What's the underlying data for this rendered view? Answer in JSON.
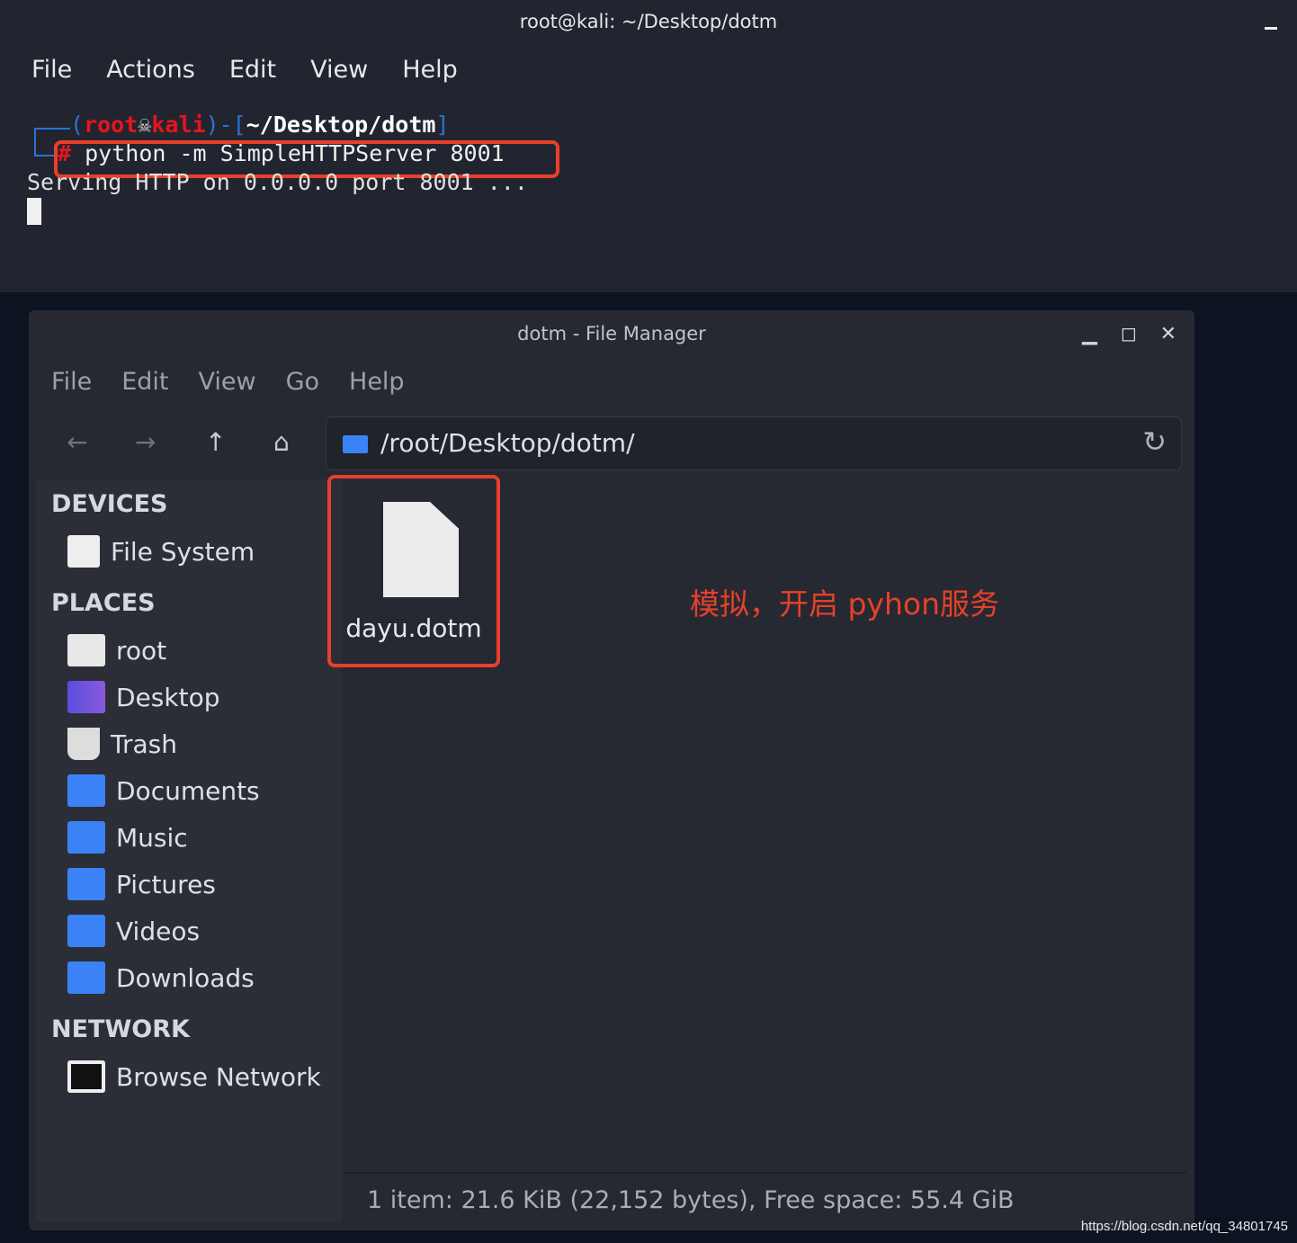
{
  "terminal": {
    "title": "root@kali: ~/Desktop/dotm",
    "menu": [
      "File",
      "Actions",
      "Edit",
      "View",
      "Help"
    ],
    "prompt_user": "root",
    "prompt_host": "kali",
    "prompt_path": "~/Desktop/dotm",
    "prompt_symbol": "#",
    "command": "python -m SimpleHTTPServer 8001",
    "output": "Serving HTTP on 0.0.0.0 port 8001 ..."
  },
  "fm": {
    "title": "dotm - File Manager",
    "menu": [
      "File",
      "Edit",
      "View",
      "Go",
      "Help"
    ],
    "path": "/root/Desktop/dotm/",
    "sidebar": {
      "devices": "DEVICES",
      "places": "PLACES",
      "network": "NETWORK",
      "device_items": [
        "File System"
      ],
      "place_items": [
        "root",
        "Desktop",
        "Trash",
        "Documents",
        "Music",
        "Pictures",
        "Videos",
        "Downloads"
      ],
      "network_items": [
        "Browse Network"
      ]
    },
    "file": "dayu.dotm",
    "annotation": "模拟，开启 pyhon服务",
    "status": "1 item: 21.6 KiB (22,152 bytes), Free space: 55.4 GiB"
  },
  "watermark": "https://blog.csdn.net/qq_34801745",
  "colors": {
    "accent": "#3b82f6",
    "highlight": "#e8402a",
    "prompt": "#e8141c"
  }
}
